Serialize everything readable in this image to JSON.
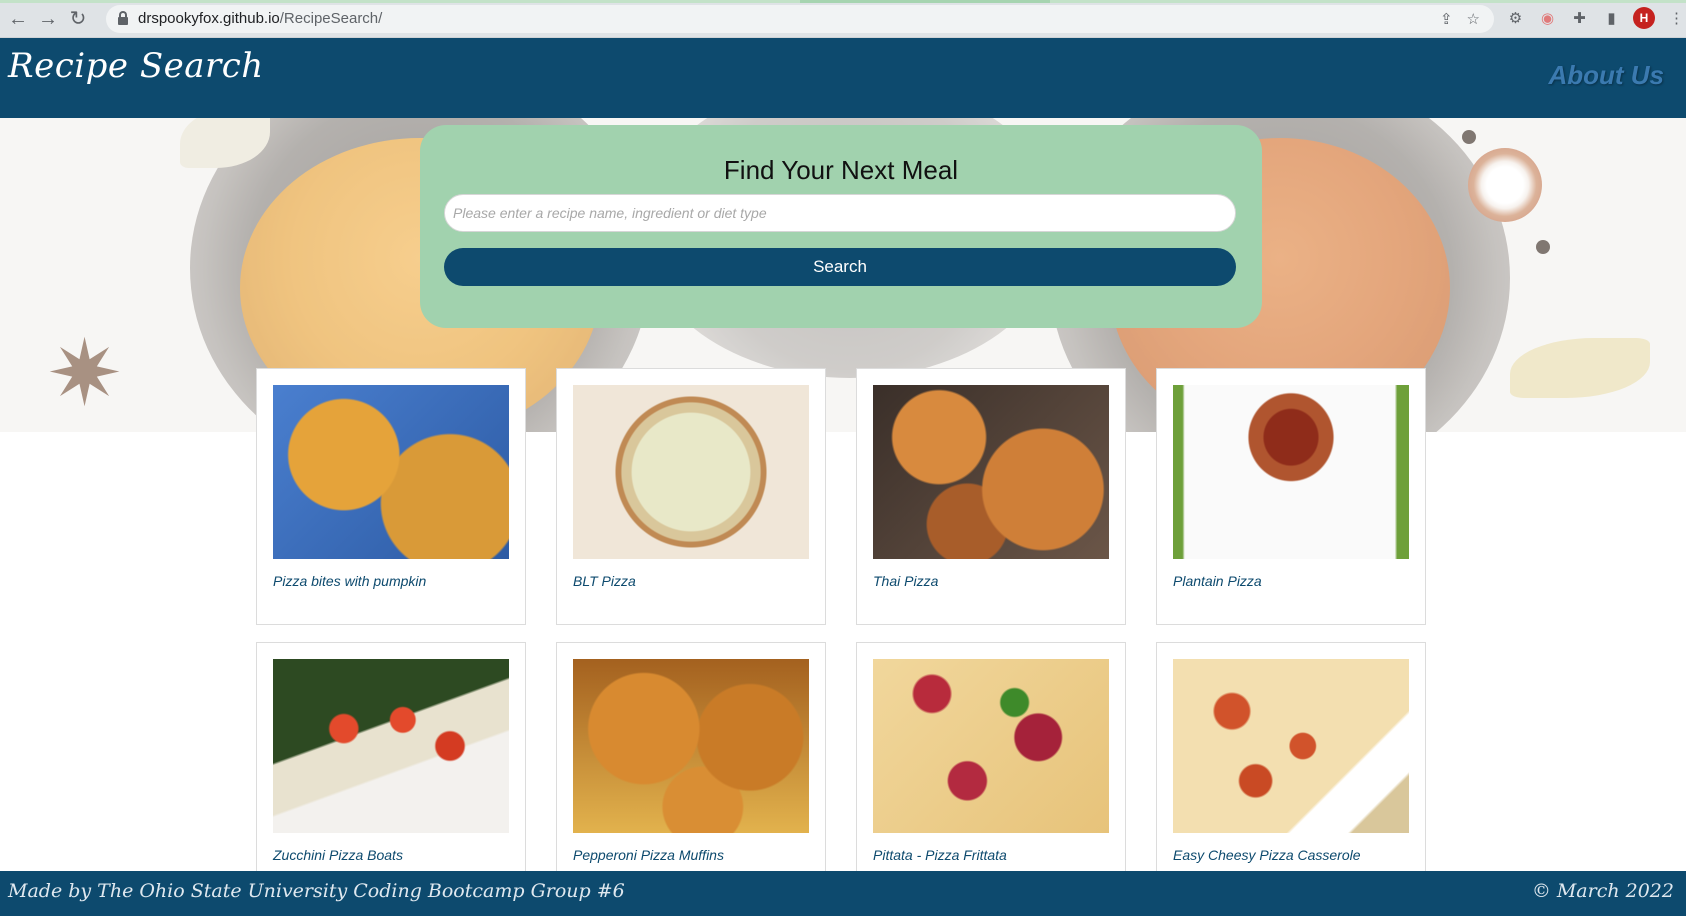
{
  "browser": {
    "url_host": "drspookyfox.github.io",
    "url_path": "/RecipeSearch/",
    "avatar_initial": "H"
  },
  "header": {
    "logo": "Recipe Search",
    "about_link": "About Us"
  },
  "search": {
    "title": "Find Your Next Meal",
    "placeholder": "Please enter a recipe name, ingredient or diet type",
    "button_label": "Search"
  },
  "recipes": [
    {
      "title": "Pizza bites with pumpkin",
      "image": "pizza-bites-photo"
    },
    {
      "title": "BLT Pizza",
      "image": "blt-pizza-photo"
    },
    {
      "title": "Thai Pizza",
      "image": "thai-pizza-photo"
    },
    {
      "title": "Plantain Pizza",
      "image": "plantain-pizza-photo"
    },
    {
      "title": "Zucchini Pizza Boats",
      "image": "zucchini-boats-photo"
    },
    {
      "title": "Pepperoni Pizza Muffins",
      "image": "pizza-muffins-photo"
    },
    {
      "title": "Pittata - Pizza Frittata",
      "image": "pittata-photo"
    },
    {
      "title": "Easy Cheesy Pizza Casserole",
      "image": "casserole-photo"
    }
  ],
  "footer": {
    "credit": "Made by The Ohio State University Coding Bootcamp Group #6",
    "date": "© March 2022"
  },
  "colors": {
    "header_bg": "#0d4a6e",
    "search_card_bg": "#a1d2ae",
    "accent_link": "#3b7ab0"
  }
}
